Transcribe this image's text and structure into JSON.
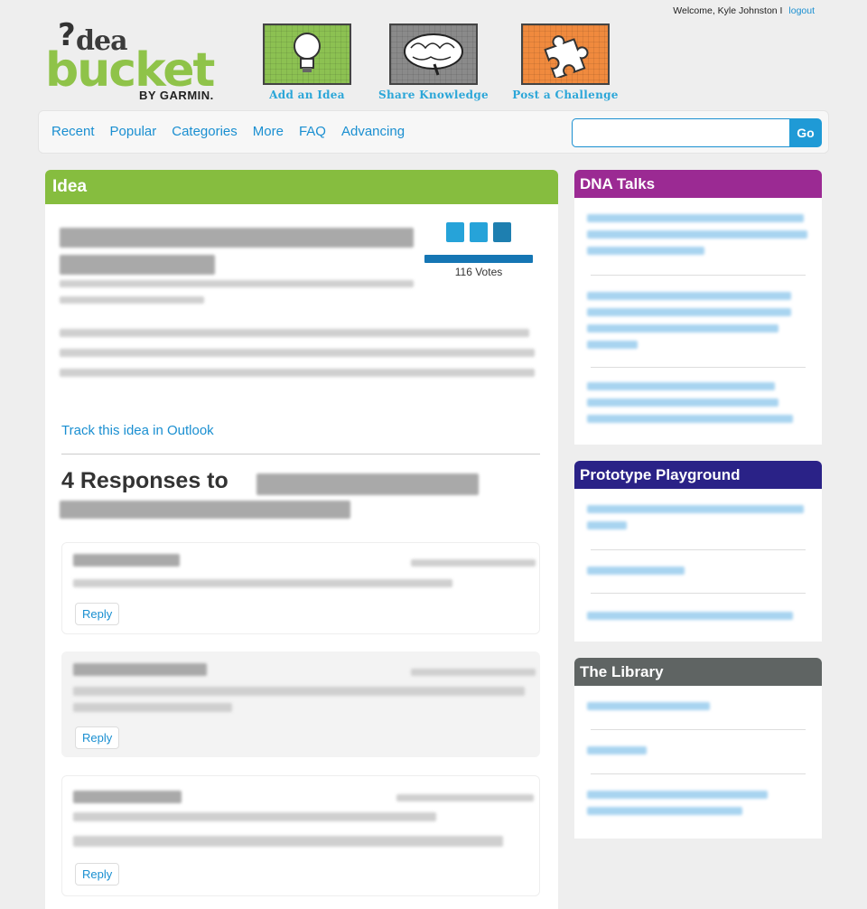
{
  "user": {
    "welcome": "Welcome, Kyle Johnston I",
    "logout": "logout"
  },
  "logo": {
    "qmark": "?",
    "idea": "dea",
    "bucket": "bucket",
    "byline": "BY GARMIN."
  },
  "actions": [
    {
      "label": "Add an Idea",
      "icon": "lightbulb-icon"
    },
    {
      "label": "Share Knowledge",
      "icon": "brain-icon"
    },
    {
      "label": "Post a Challenge",
      "icon": "puzzle-icon"
    }
  ],
  "nav": [
    "Recent",
    "Popular",
    "Categories",
    "More",
    "FAQ",
    "Advancing"
  ],
  "search": {
    "placeholder": "",
    "button": "Go"
  },
  "idea": {
    "header": "Idea",
    "votes": "116 Votes",
    "track_link": "Track this idea in Outlook",
    "responses_title": "4 Responses to",
    "reply_label": "Reply"
  },
  "sidebar": [
    {
      "title": "DNA Talks",
      "color": "#9b2a93"
    },
    {
      "title": "Prototype Playground",
      "color": "#2a2287"
    },
    {
      "title": "The Library",
      "color": "#5f6463"
    }
  ]
}
